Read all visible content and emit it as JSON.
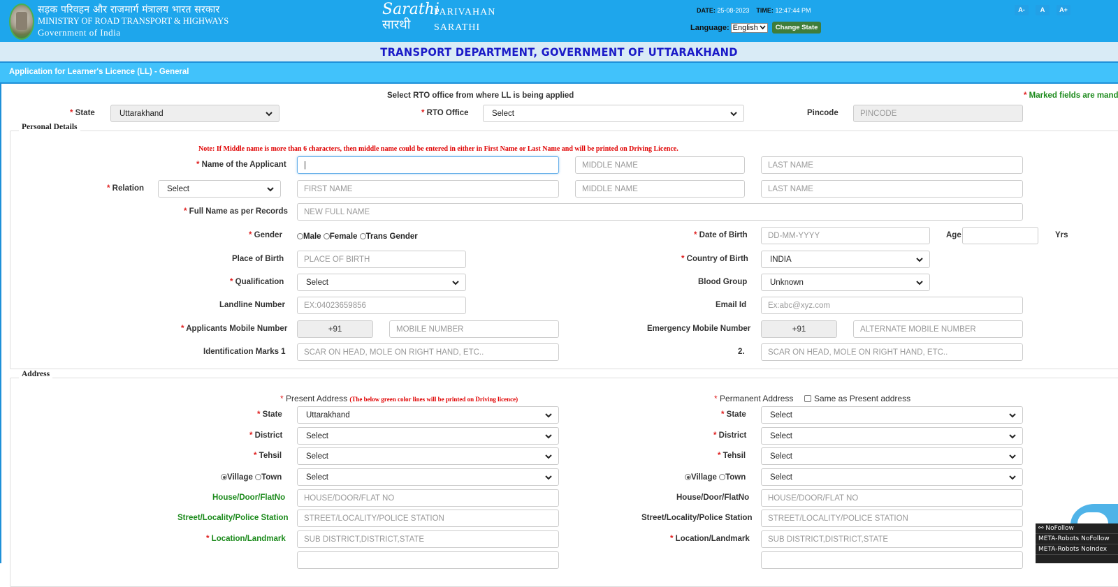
{
  "header": {
    "ministry_hindi": "सड़क परिवहन और राजमार्ग मंत्रालय भारत सरकार",
    "ministry_english": "MINISTRY OF ROAD TRANSPORT & HIGHWAYS",
    "government": "Government of India",
    "logo_script_1": "Sarathi",
    "logo_script_2": "सारथी",
    "parivahan": "PARIVAHAN",
    "sarathi": "SARATHI",
    "date_label": "DATE:",
    "date_value": "25-08-2023",
    "time_label": "TIME:",
    "time_value": "12:47:44 PM",
    "language_label": "Language:",
    "language_value": "English",
    "change_state_label": "Change State",
    "font_buttons": [
      "A-",
      "A",
      "A+"
    ]
  },
  "department_title": "TRANSPORT DEPARTMENT, GOVERNMENT OF UTTARAKHAND",
  "application_title": "Application for Learner's Licence (LL) - General",
  "rto_section": {
    "instruction": "Select RTO office from where LL is being applied",
    "mandatory_note": "Marked fields are mandatory",
    "state_label": "State",
    "state_value": "Uttarakhand",
    "rto_label": "RTO Office",
    "rto_value": "Select",
    "pincode_label": "Pincode",
    "pincode_placeholder": "PINCODE"
  },
  "personal_details": {
    "legend": "Personal Details",
    "note": "Note: If Middle name is more than 6 characters, then middle name could be entered in either in First Name or Last Name and will be printed on Driving Licence.",
    "applicant_name_label": "Name of the Applicant",
    "applicant_first_value": "|",
    "middle_name_placeholder": "MIDDLE NAME",
    "last_name_placeholder": "LAST NAME",
    "relation_label": "Relation",
    "relation_value": "Select",
    "first_name_placeholder": "FIRST NAME",
    "full_name_label": "Full Name as per Records",
    "full_name_placeholder": "NEW FULL NAME",
    "gender_label": "Gender",
    "gender_options": [
      "Male",
      "Female",
      "Trans Gender"
    ],
    "dob_label": "Date of Birth",
    "dob_placeholder": "DD-MM-YYYY",
    "age_label": "Age",
    "age_unit": "Yrs",
    "place_of_birth_label": "Place of Birth",
    "place_of_birth_placeholder": "PLACE OF BIRTH",
    "country_of_birth_label": "Country of Birth",
    "country_of_birth_value": "INDIA",
    "qualification_label": "Qualification",
    "qualification_value": "Select",
    "blood_group_label": "Blood Group",
    "blood_group_value": "Unknown",
    "landline_label": "Landline Number",
    "landline_placeholder": "EX:04023659856",
    "email_label": "Email Id",
    "email_placeholder": "Ex:abc@xyz.com",
    "mobile_label": "Applicants Mobile Number",
    "country_code": "+91",
    "mobile_placeholder": "MOBILE NUMBER",
    "emergency_label": "Emergency Mobile Number",
    "emergency_placeholder": "ALTERNATE MOBILE NUMBER",
    "id_marks_label": "Identification Marks 1",
    "id_marks_2_label": "2.",
    "id_marks_placeholder": "SCAR ON HEAD, MOLE ON RIGHT HAND, ETC.."
  },
  "address": {
    "legend": "Address",
    "present_label": "Present Address",
    "present_note": "(The below green color lines will be printed on Driving licence)",
    "permanent_label": "Permanent Address",
    "same_as_present_label": "Same as Present address",
    "state_label": "State",
    "district_label": "District",
    "tehsil_label": "Tehsil",
    "village_label": "Village",
    "town_label": "Town",
    "house_label": "House/Door/FlatNo",
    "house_placeholder": "HOUSE/DOOR/FLAT NO",
    "street_label": "Street/Locality/Police Station",
    "street_placeholder": "STREET/LOCALITY/POLICE STATION",
    "location_label": "Location/Landmark",
    "location_placeholder": "SUB DISTRICT,DISTRICT,STATE",
    "present_state_value": "Uttarakhand",
    "select_value": "Select"
  },
  "extension_overlay": {
    "title": "NoFollow",
    "line1": "META-Robots NoFollow",
    "line2": "META-Robots NoIndex"
  },
  "colors": {
    "header_blue": "#1ea6ec",
    "title_bar": "#41c2fb",
    "dept_text": "#1a1ac8",
    "required_red": "#e02020",
    "printed_green": "#1b8a1b",
    "change_state_green": "#3f7d3a"
  }
}
